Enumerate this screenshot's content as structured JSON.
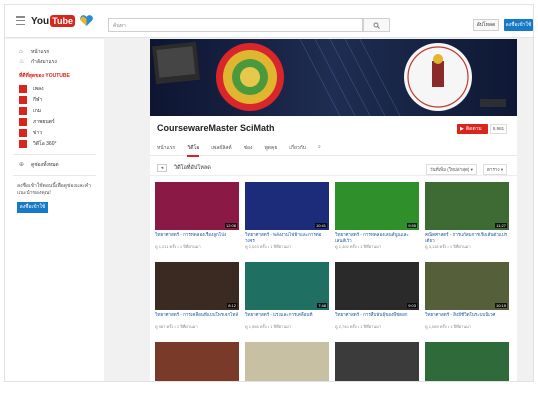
{
  "header": {
    "logo_you": "You",
    "logo_tube": "Tube",
    "search_placeholder": "ค้นหา",
    "upload_label": "อัปโหลด",
    "signin_label": "ลงชื่อเข้าใช้"
  },
  "sidebar": {
    "items": [
      {
        "label": "หน้าแรก",
        "icon": "home-icon"
      },
      {
        "label": "กำลังมาแรง",
        "icon": "flame-icon"
      }
    ],
    "section_title": "ที่ดีที่สุดของ YOUTUBE",
    "channels": [
      {
        "label": "เพลง",
        "color": "#d9261c"
      },
      {
        "label": "กีฬา",
        "color": "#d9261c"
      },
      {
        "label": "เกม",
        "color": "#d9261c"
      },
      {
        "label": "ภาพยนตร์",
        "color": "#d9261c"
      },
      {
        "label": "ข่าว",
        "color": "#d9261c"
      },
      {
        "label": "วิดีโอ 360°",
        "color": "#d9261c"
      }
    ],
    "browse_label": "ดูช่องทั้งหมด",
    "note": "ลงชื่อเข้าใช้ตอนนี้เพื่อดูช่องและคำแนะนำของคุณ!",
    "signin_label": "ลงชื่อเข้าใช้"
  },
  "channel": {
    "title": "CoursewareMaster SciMath",
    "subscribe_label": "ติดตาม",
    "subscriber_count": "5,981",
    "tabs": [
      "หน้าแรก",
      "วิดีโอ",
      "เพลย์ลิสต์",
      "ช่อง",
      "พูดคุย",
      "เกี่ยวกับ"
    ],
    "active_tab": "วิดีโอ",
    "search_tab_icon": "search-icon"
  },
  "filter": {
    "title": "วิดีโอที่อัปโหลด",
    "sort_label": "วันที่เพิ่ม (ใหม่ล่าสุด) ▾",
    "view_label": "ตาราง ▾"
  },
  "videos": [
    {
      "title": "วิทยาศาสตร์ - การทดลองเรื่องลูกโป่ง",
      "meta": "ดู 1,211 ครั้ง • 1 ปีที่ผ่านมา",
      "duration": "12:08",
      "thumb": "#8a1a45"
    },
    {
      "title": "วิทยาศาสตร์ - พลังงานไฟฟ้าและการต่อวงจร",
      "meta": "ดู 2,023 ครั้ง • 1 ปีที่ผ่านมา",
      "duration": "10:41",
      "thumb": "#1d2c7a"
    },
    {
      "title": "วิทยาศาสตร์ - การทดลองเลนส์นูนและเลนส์เว้า",
      "meta": "ดู 1,402 ครั้ง • 1 ปีที่ผ่านมา",
      "duration": "9:55",
      "thumb": "#2f8f2a"
    },
    {
      "title": "คณิตศาสตร์ - การแก้สมการเชิงเส้นตัวแปรเดียว",
      "meta": "ดู 3,118 ครั้ง • 1 ปีที่ผ่านมา",
      "duration": "11:27",
      "thumb": "#3e6b34"
    },
    {
      "title": "วิทยาศาสตร์ - การเคลื่อนที่แบบโพรเจกไทล์",
      "meta": "ดู 987 ครั้ง • 1 ปีที่ผ่านมา",
      "duration": "8:12",
      "thumb": "#3a2a22"
    },
    {
      "title": "วิทยาศาสตร์ - แรงและการเคลื่อนที่",
      "meta": "ดู 1,556 ครั้ง • 1 ปีที่ผ่านมา",
      "duration": "7:48",
      "thumb": "#1f6f62"
    },
    {
      "title": "วิทยาศาสตร์ - การสืบพันธุ์ของพืชดอก",
      "meta": "ดู 2,740 ครั้ง • 1 ปีที่ผ่านมา",
      "duration": "9:03",
      "thumb": "#2a2a2a"
    },
    {
      "title": "วิทยาศาสตร์ - สิ่งมีชีวิตในระบบนิเวศ",
      "meta": "ดู 1,089 ครั้ง • 1 ปีที่ผ่านมา",
      "duration": "10:19",
      "thumb": "#55603a"
    },
    {
      "title": "วิทยาศาสตร์ - เซลล์ของสิ่งมีชีวิต",
      "meta": "ดู 845 ครั้ง • 1 ปีที่ผ่านมา",
      "duration": "6:30",
      "thumb": "#7a3a2a"
    },
    {
      "title": "คณิตศาสตร์ - สถิติและความน่าจะเป็น",
      "meta": "ดู 1,320 ครั้ง • 1 ปีที่ผ่านมา",
      "duration": "8:44",
      "thumb": "#c8c0a2"
    },
    {
      "title": "วิทยาศาสตร์ - ปฏิกิริยาเคมี",
      "meta": "ดู 1,677 ครั้ง • 1 ปีที่ผ่านมา",
      "duration": "9:21",
      "thumb": "#3b3b3b"
    },
    {
      "title": "คณิตศาสตร์ - เรขาคณิตวิเคราะห์",
      "meta": "ดู 902 ครั้ง • 1 ปีที่ผ่านมา",
      "duration": "7:15",
      "thumb": "#2e6a3a"
    }
  ],
  "colors": {
    "brand_red": "#d9261c",
    "link_blue": "#1b56a5",
    "button_blue": "#167ac6"
  }
}
